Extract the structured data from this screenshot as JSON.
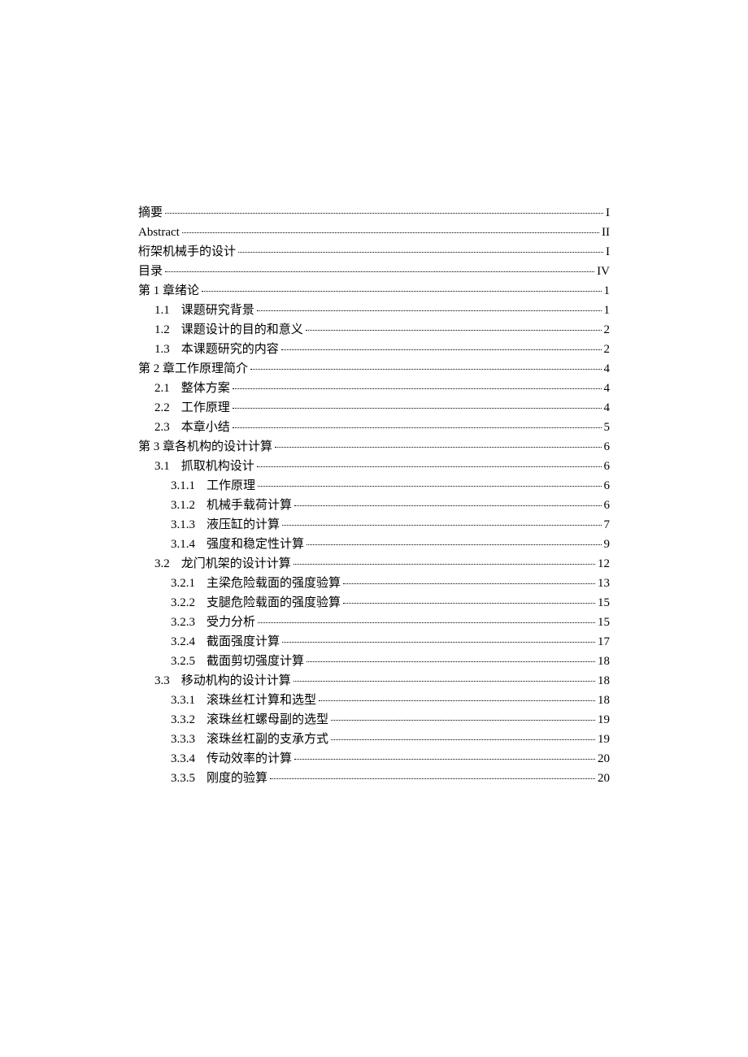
{
  "toc": [
    {
      "level": 0,
      "num": "",
      "title": "摘要",
      "page": "I"
    },
    {
      "level": 0,
      "num": "",
      "title": "Abstract",
      "page": "II"
    },
    {
      "level": 0,
      "num": "",
      "title": "桁架机械手的设计",
      "page": "I"
    },
    {
      "level": 0,
      "num": "",
      "title": "目录",
      "page": "IV"
    },
    {
      "level": 0,
      "num": "",
      "title": "第 1 章绪论",
      "page": "1"
    },
    {
      "level": 1,
      "num": "1.1",
      "title": "课题研究背景",
      "page": "1"
    },
    {
      "level": 1,
      "num": "1.2",
      "title": "课题设计的目的和意义",
      "page": "2"
    },
    {
      "level": 1,
      "num": "1.3",
      "title": "本课题研究的内容",
      "page": "2"
    },
    {
      "level": 0,
      "num": "",
      "title": "第 2 章工作原理简介",
      "page": "4"
    },
    {
      "level": 1,
      "num": "2.1",
      "title": "整体方案",
      "page": "4"
    },
    {
      "level": 1,
      "num": "2.2",
      "title": "工作原理",
      "page": "4"
    },
    {
      "level": 1,
      "num": "2.3",
      "title": "本章小结",
      "page": "5"
    },
    {
      "level": 0,
      "num": "",
      "title": "第 3 章各机构的设计计算",
      "page": "6"
    },
    {
      "level": 1,
      "num": "3.1",
      "title": "抓取机构设计",
      "page": "6"
    },
    {
      "level": 2,
      "num": "3.1.1",
      "title": "工作原理",
      "page": "6"
    },
    {
      "level": 2,
      "num": "3.1.2",
      "title": "机械手载荷计算",
      "page": "6"
    },
    {
      "level": 2,
      "num": "3.1.3",
      "title": "液压缸的计算",
      "page": "7"
    },
    {
      "level": 2,
      "num": "3.1.4",
      "title": "强度和稳定性计算",
      "page": "9"
    },
    {
      "level": 1,
      "num": "3.2",
      "title": "龙门机架的设计计算",
      "page": "12"
    },
    {
      "level": 2,
      "num": "3.2.1",
      "title": "主梁危险载面的强度验算",
      "page": "13"
    },
    {
      "level": 2,
      "num": "3.2.2",
      "title": "支腿危险载面的强度验算",
      "page": "15"
    },
    {
      "level": 2,
      "num": "3.2.3",
      "title": "受力分析",
      "page": "15"
    },
    {
      "level": 2,
      "num": "3.2.4",
      "title": "截面强度计算",
      "page": "17"
    },
    {
      "level": 2,
      "num": "3.2.5",
      "title": "截面剪切强度计算",
      "page": "18"
    },
    {
      "level": 1,
      "num": "3.3",
      "title": "移动机构的设计计算",
      "page": "18"
    },
    {
      "level": 2,
      "num": "3.3.1",
      "title": "滚珠丝杠计算和选型",
      "page": "18"
    },
    {
      "level": 2,
      "num": "3.3.2",
      "title": "滚珠丝杠螺母副的选型",
      "page": "19"
    },
    {
      "level": 2,
      "num": "3.3.3",
      "title": "滚珠丝杠副的支承方式",
      "page": "19"
    },
    {
      "level": 2,
      "num": "3.3.4",
      "title": "传动效率的计算",
      "page": "20"
    },
    {
      "level": 2,
      "num": "3.3.5",
      "title": "刚度的验算",
      "page": "20"
    }
  ]
}
